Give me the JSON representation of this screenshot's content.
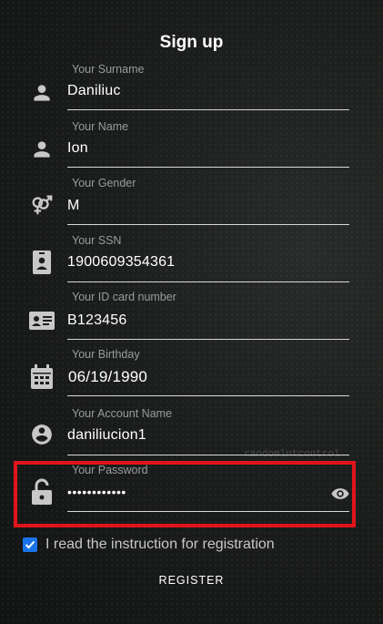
{
  "title": "Sign up",
  "fields": [
    {
      "label": "Your Surname",
      "value": "Daniliuc",
      "icon": "person-icon"
    },
    {
      "label": "Your Name",
      "value": "Ion",
      "icon": "person-icon"
    },
    {
      "label": "Your Gender",
      "value": "M",
      "icon": "gender-icon"
    },
    {
      "label": "Your SSN",
      "value": "1900609354361",
      "icon": "badge-icon"
    },
    {
      "label": "Your ID card number",
      "value": "B123456",
      "icon": "id-card-icon"
    },
    {
      "label": "Your Birthday",
      "value": "06/19/1990",
      "icon": "calendar-icon"
    },
    {
      "label": "Your Account Name",
      "value": "daniliucion1",
      "icon": "account-circle-icon"
    },
    {
      "label": "Your Password",
      "value": "••••••••••••",
      "icon": "lock-open-icon"
    }
  ],
  "password_toggle_icon": "eye-icon",
  "checkbox": {
    "label": "I read the instruction for registration",
    "checked": true
  },
  "register_label": "REGISTER",
  "background_text": "randomlntcontrol",
  "colors": {
    "accent": "#1a73e8",
    "highlight": "#e0141a",
    "icon": "#c8c8c8"
  }
}
